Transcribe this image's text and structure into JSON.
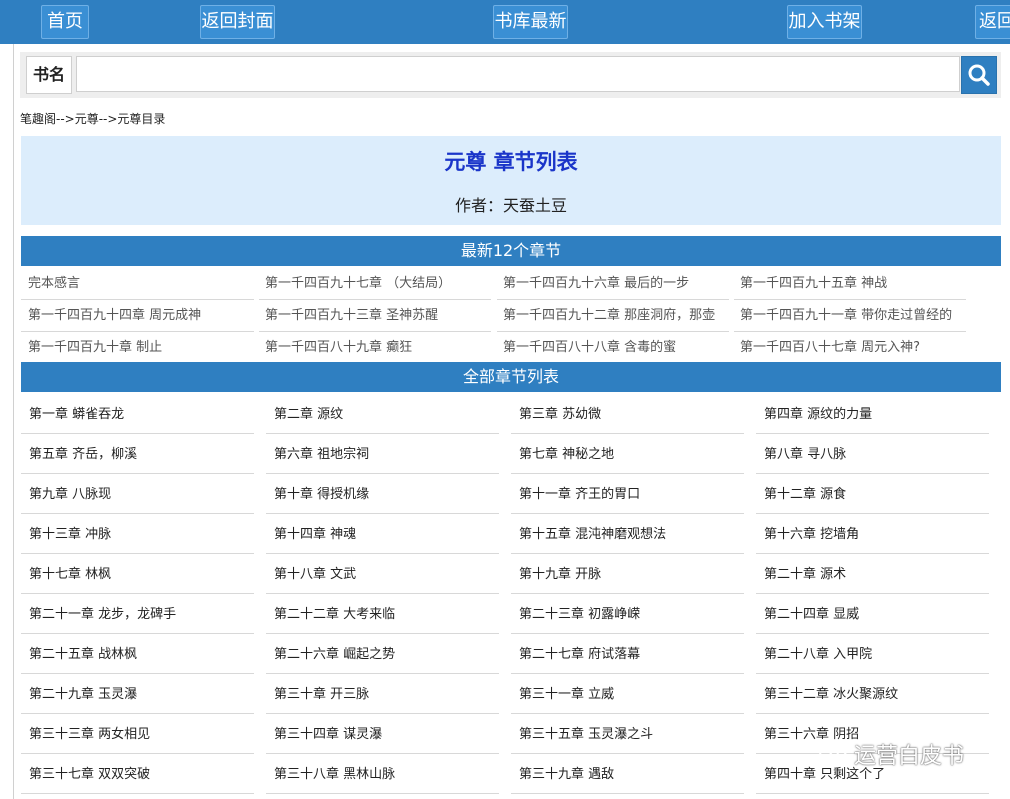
{
  "nav": {
    "home": "首页",
    "back_cover": "返回封面",
    "library_latest": "书库最新",
    "add_shelf": "加入书架",
    "back_partial": "返回"
  },
  "search": {
    "label": "书名",
    "value": "",
    "placeholder": ""
  },
  "breadcrumb": "笔趣阁-->元尊-->元尊目录",
  "book": {
    "title": "元尊 章节列表",
    "author": "作者：天蚕土豆"
  },
  "latest_header": "最新12个章节",
  "latest": [
    "完本感言",
    "第一千四百九十七章 （大结局）",
    "第一千四百九十六章 最后的一步",
    "第一千四百九十五章 神战",
    "第一千四百九十四章 周元成神",
    "第一千四百九十三章 圣神苏醒",
    "第一千四百九十二章 那座洞府，那壶",
    "第一千四百九十一章 带你走过曾经的",
    "第一千四百九十章 制止",
    "第一千四百八十九章 癫狂",
    "第一千四百八十八章 含毒的蜜",
    "第一千四百八十七章 周元入神?"
  ],
  "all_header": "全部章节列表",
  "chapters": [
    "第一章 蟒雀吞龙",
    "第二章 源纹",
    "第三章 苏幼微",
    "第四章 源纹的力量",
    "第五章 齐岳，柳溪",
    "第六章 祖地宗祠",
    "第七章 神秘之地",
    "第八章 寻八脉",
    "第九章 八脉现",
    "第十章 得授机缘",
    "第十一章 齐王的胃口",
    "第十二章 源食",
    "第十三章 冲脉",
    "第十四章 神魂",
    "第十五章 混沌神磨观想法",
    "第十六章 挖墙角",
    "第十七章 林枫",
    "第十八章 文武",
    "第十九章 开脉",
    "第二十章 源术",
    "第二十一章 龙步，龙碑手",
    "第二十二章 大考来临",
    "第二十三章 初露峥嵘",
    "第二十四章 显威",
    "第二十五章 战林枫",
    "第二十六章 崛起之势",
    "第二十七章 府试落幕",
    "第二十八章 入甲院",
    "第二十九章 玉灵瀑",
    "第三十章 开三脉",
    "第三十一章 立威",
    "第三十二章 冰火聚源纹",
    "第三十三章 两女相见",
    "第三十四章 谋灵瀑",
    "第三十五章 玉灵瀑之斗",
    "第三十六章 阴招",
    "第三十七章 双双突破",
    "第三十八章 黑林山脉",
    "第三十九章 遇敌",
    "第四十章 只剩这个了"
  ],
  "watermark": "运营白皮书",
  "icons": {
    "search": "search-icon",
    "watermark": "wechat-icon"
  }
}
